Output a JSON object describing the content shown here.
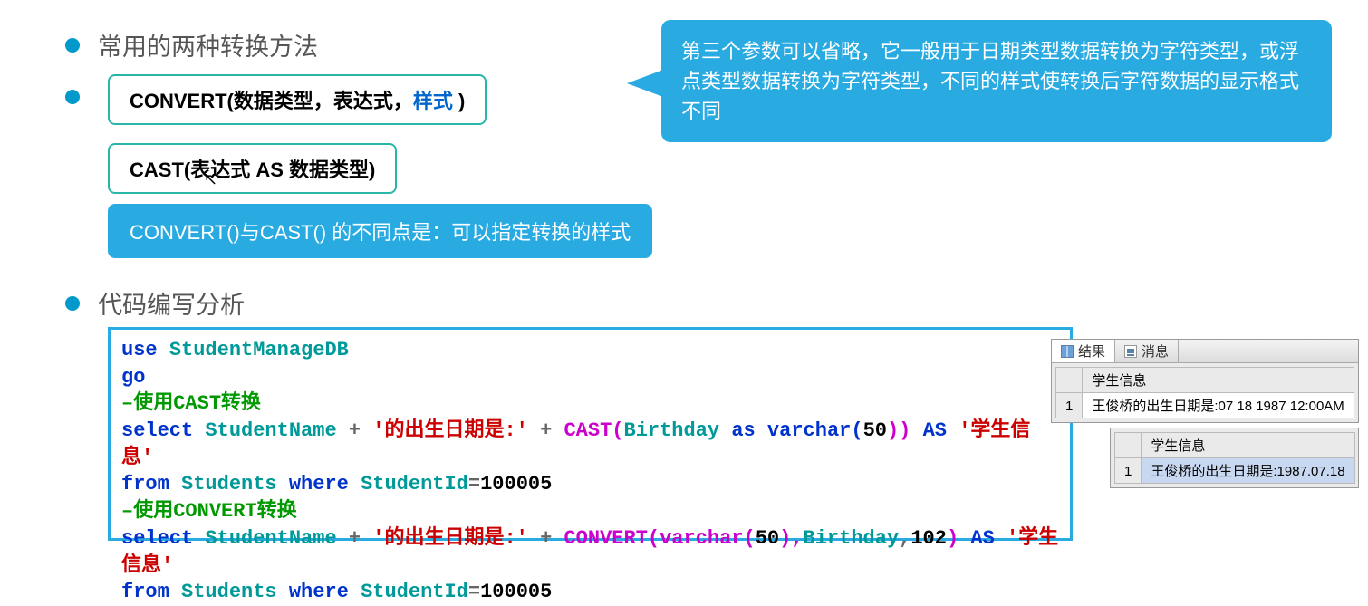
{
  "headings": {
    "h1": "常用的两种转换方法",
    "h2": "代码编写分析"
  },
  "syntax": {
    "convert": {
      "fn": "CONVERT(",
      "args": "数据类型，表达式，",
      "style_kw": "样式 ",
      "close": ")"
    },
    "cast": {
      "text": "CAST(表达式 AS 数据类型)"
    }
  },
  "callout": "第三个参数可以省略，它一般用于日期类型数据转换为字符类型，或浮点类型数据转换为字符类型，不同的样式使转换后字符数据的显示格式不同",
  "note": "CONVERT()与CAST() 的不同点是：可以指定转换的样式",
  "code": {
    "l1_use": "use ",
    "l1_db": "StudentManageDB",
    "l2": "go",
    "l3_prefix": "–",
    "l3_text": "使用",
    "l3_fn": "CAST",
    "l3_suffix": "转换",
    "l4_select": "select  ",
    "l4_col": "StudentName ",
    "l4_plus1": "+ ",
    "l4_str": "'的出生日期是:' ",
    "l4_plus2": "+ ",
    "l4_cast": "CAST(",
    "l4_bday": "Birthday ",
    "l4_as": "as varchar(",
    "l4_num": "50",
    "l4_close": ")) ",
    "l4_askw": "AS ",
    "l4_alias": "'学生信息'",
    "l5_from": "from ",
    "l5_tbl": "Students ",
    "l5_where": "where ",
    "l5_col": "StudentId",
    "l5_eq": "=",
    "l5_val": "100005",
    "l6_prefix": "–",
    "l6_text": "使用",
    "l6_fn": "CONVERT",
    "l6_suffix": "转换",
    "l7_select": "select  ",
    "l7_col": "StudentName ",
    "l7_plus1": "+ ",
    "l7_str": "'的出生日期是:' ",
    "l7_plus2": "+ ",
    "l7_conv": "CONVERT(varchar(",
    "l7_num1": "50",
    "l7_mid": "),",
    "l7_bday": "Birthday",
    "l7_comma": ",",
    "l7_num2": "102",
    "l7_close": ") ",
    "l7_askw": "AS ",
    "l7_alias": "'学生信息'",
    "l8_from": "from ",
    "l8_tbl": "Students ",
    "l8_where": "where ",
    "l8_col": "StudentId",
    "l8_eq": "=",
    "l8_val": "100005"
  },
  "results": {
    "tab_results": "结果",
    "tab_messages": "消息",
    "header": "学生信息",
    "row1_num": "1",
    "row1_val": "王俊桥的出生日期是:07 18 1987 12:00AM",
    "row2_num": "1",
    "row2_val": "王俊桥的出生日期是:1987.07.18"
  }
}
